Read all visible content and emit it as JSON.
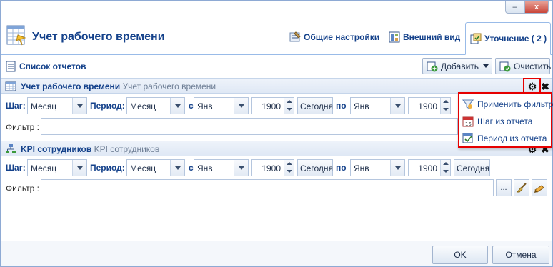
{
  "window": {
    "title": "Учет рабочего времени",
    "minimize_label": "–",
    "close_label": "x"
  },
  "header_tabs": [
    {
      "label": "Общие настройки",
      "icon": "settings-icon"
    },
    {
      "label": "Внешний вид",
      "icon": "view-icon"
    },
    {
      "label": "Уточнение ( 2 )",
      "icon": "refine-icon"
    }
  ],
  "toolbar": {
    "label": "Список отчетов",
    "add_label": "Добавить",
    "clear_label": "Очистить"
  },
  "reports": [
    {
      "title": "Учет рабочего времени",
      "subtitle": "Учет рабочего времени",
      "step_label": "Шаг:",
      "step_value": "Месяц",
      "period_label": "Период:",
      "period_value": "Месяц",
      "from_label": "с",
      "from_month": "Янв",
      "from_year": "1900",
      "today_label": "Сегодня",
      "to_label": "по",
      "to_month": "Янв",
      "to_year": "1900",
      "filter_label": "Фильтр :",
      "filter_value": ""
    },
    {
      "title": "KPI сотрудников",
      "subtitle": "KPI сотрудников",
      "step_label": "Шаг:",
      "step_value": "Месяц",
      "period_label": "Период:",
      "period_value": "Месяц",
      "from_label": "с",
      "from_month": "Янв",
      "from_year": "1900",
      "today_label": "Сегодня",
      "to_label": "по",
      "to_month": "Янв",
      "to_year": "1900",
      "today2_label": "Сегодня",
      "filter_label": "Фильтр :",
      "filter_value": "",
      "browse_label": "..."
    }
  ],
  "context_menu": {
    "items": [
      {
        "label": "Применить фильтр",
        "icon": "filter-icon"
      },
      {
        "label": "Шаг из отчета",
        "icon": "calendar-icon"
      },
      {
        "label": "Период из отчета",
        "icon": "period-icon"
      }
    ]
  },
  "footer": {
    "ok_label": "OK",
    "cancel_label": "Отмена"
  },
  "colors": {
    "accent": "#15428b",
    "highlight": "#e60000",
    "border": "#99bbe8"
  }
}
